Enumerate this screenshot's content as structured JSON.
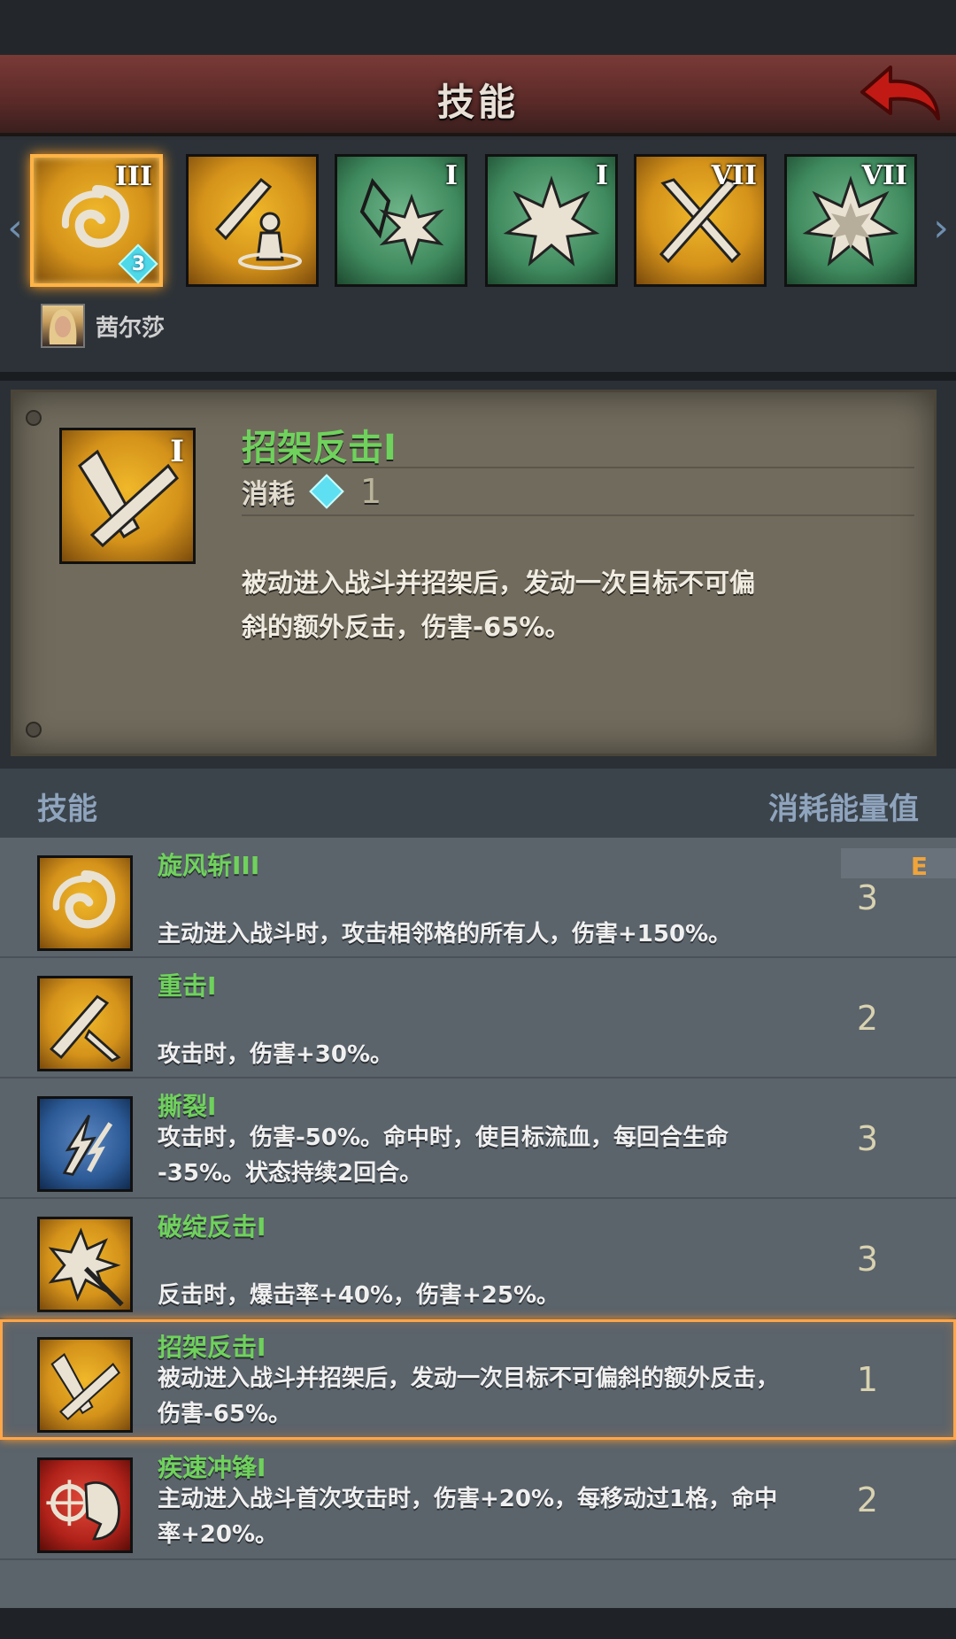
{
  "header": {
    "title": "技能"
  },
  "strip": {
    "slots": [
      {
        "icon": "whirlwind-icon",
        "color": "gold",
        "numeral": "III",
        "badge": "3"
      },
      {
        "icon": "sword-guard-icon",
        "color": "gold",
        "numeral": ""
      },
      {
        "icon": "crystal-burst-icon",
        "color": "green",
        "numeral": "I"
      },
      {
        "icon": "burst-icon",
        "color": "green",
        "numeral": "I"
      },
      {
        "icon": "crossed-swords-icon",
        "color": "gold",
        "numeral": "VII"
      },
      {
        "icon": "burst-icon",
        "color": "green",
        "numeral": "VII"
      }
    ],
    "character": {
      "name": "茜尔莎"
    }
  },
  "detail": {
    "numeral": "I",
    "title": "招架反击I",
    "cost_label": "消耗",
    "cost_value": "1",
    "desc_line1": "被动进入战斗并招架后，发动一次目标不可偏",
    "desc_line2": "斜的额外反击，伤害-65%。"
  },
  "list_header": {
    "left": "技能",
    "right": "消耗能量值"
  },
  "list_marker": "E",
  "skills": [
    {
      "name": "旋风斩III",
      "desc1": "",
      "desc2": "主动进入战斗时，攻击相邻格的所有人，伤害+150%。",
      "cost": "3",
      "color": "gold",
      "icon": "whirlwind-icon"
    },
    {
      "name": "重击I",
      "desc1": "",
      "desc2": "攻击时，伤害+30%。",
      "cost": "2",
      "color": "gold",
      "icon": "sword-strike-icon"
    },
    {
      "name": "撕裂I",
      "desc1": "攻击时，伤害-50%。命中时，使目标流血，每回合生命",
      "desc2": "-35%。状态持续2回合。",
      "cost": "3",
      "color": "blue",
      "icon": "tear-icon"
    },
    {
      "name": "破绽反击I",
      "desc1": "",
      "desc2": "反击时，爆击率+40%，伤害+25%。",
      "cost": "3",
      "color": "gold",
      "icon": "counter-burst-icon"
    },
    {
      "name": "招架反击I",
      "desc1": "被动进入战斗并招架后，发动一次目标不可偏斜的额外反击，",
      "desc2": "伤害-65%。",
      "cost": "1",
      "color": "gold",
      "icon": "parry-icon"
    },
    {
      "name": "疾速冲锋I",
      "desc1": "主动进入战斗首次攻击时，伤害+20%，每移动过1格，命中",
      "desc2": "率+20%。",
      "cost": "2",
      "color": "red",
      "icon": "charge-icon"
    }
  ],
  "colors": {
    "accent": "#ffa64a",
    "skill_name": "#6fd25c",
    "header_bg": "#5a2a28"
  }
}
